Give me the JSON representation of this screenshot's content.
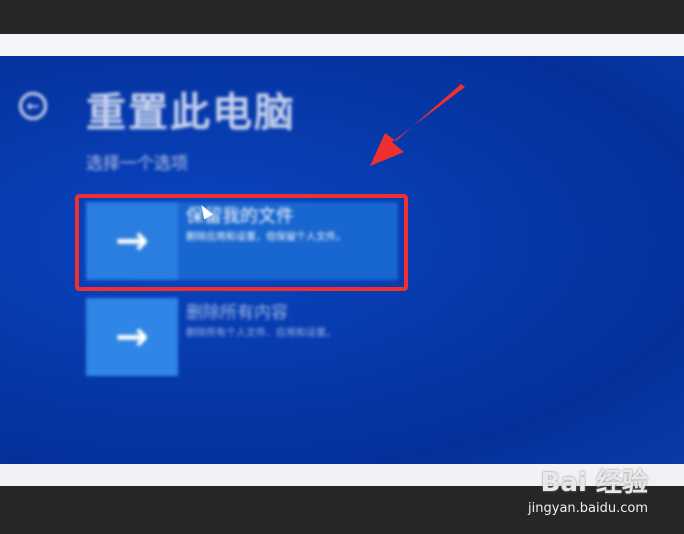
{
  "recovery": {
    "title": "重置此电脑",
    "subtitle": "选择一个选项",
    "options": [
      {
        "title": "保留我的文件",
        "description": "删除应用和设置，但保留个人文件。"
      },
      {
        "title": "删除所有内容",
        "description": "删除所有个人文件、应用和设置。"
      }
    ]
  },
  "watermark": {
    "logo": "Bai 经验",
    "url": "jingyan.baidu.com"
  },
  "icons": {
    "back": "back-arrow-icon",
    "option": "right-arrow-icon",
    "cursor": "mouse-cursor-icon"
  },
  "colors": {
    "screen_blue": "#0638a8",
    "option_selected": "#1866d0",
    "annotation_red": "#f03030"
  }
}
